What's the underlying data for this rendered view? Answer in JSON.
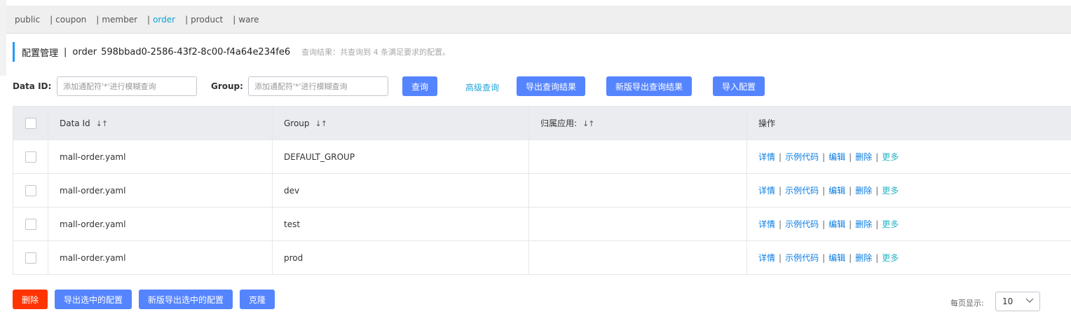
{
  "namespaces": [
    {
      "label": "public",
      "sep": ""
    },
    {
      "label": "coupon",
      "sep": "|"
    },
    {
      "label": "member",
      "sep": "|"
    },
    {
      "label": "order",
      "sep": "|"
    },
    {
      "label": "product",
      "sep": "|"
    },
    {
      "label": "ware",
      "sep": "|"
    }
  ],
  "active_namespace": "order",
  "header": {
    "title": "配置管理",
    "divider": "|",
    "namespace_name": "order",
    "namespace_id": "598bbad0-2586-43f2-8c00-f4a64e234fe6",
    "result_text": "查询结果：共查询到 4 条满足要求的配置。"
  },
  "search": {
    "data_id_label": "Data ID:",
    "data_id_placeholder": "添加通配符'*'进行模糊查询",
    "group_label": "Group:",
    "group_placeholder": "添加通配符'*'进行模糊查询",
    "query_btn": "查询",
    "advanced_link": "高级查询",
    "export_btn": "导出查询结果",
    "new_export_btn": "新版导出查询结果",
    "import_btn": "导入配置"
  },
  "table": {
    "headers": {
      "data_id": "Data Id",
      "group": "Group",
      "app": "归属应用:",
      "ops": "操作"
    },
    "sort_glyph": "↓↑",
    "rows": [
      {
        "data_id": "mall-order.yaml",
        "group": "DEFAULT_GROUP",
        "app": ""
      },
      {
        "data_id": "mall-order.yaml",
        "group": "dev",
        "app": ""
      },
      {
        "data_id": "mall-order.yaml",
        "group": "test",
        "app": ""
      },
      {
        "data_id": "mall-order.yaml",
        "group": "prod",
        "app": ""
      }
    ],
    "ops": {
      "detail": "详情",
      "sample": "示例代码",
      "edit": "编辑",
      "delete": "删除",
      "more": "更多",
      "sep": "|"
    }
  },
  "bottom": {
    "delete_btn": "删除",
    "export_selected_btn": "导出选中的配置",
    "new_export_selected_btn": "新版导出选中的配置",
    "clone_btn": "克隆",
    "page_size_label": "每页显示:",
    "page_size": "10"
  },
  "colors": {
    "primary": "#5584ff",
    "danger": "#ff3300",
    "link": "#0a7de2",
    "active_tab": "#0aa1d6"
  }
}
